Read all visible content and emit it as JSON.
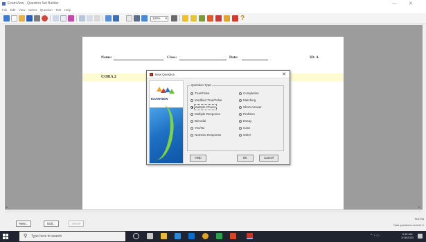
{
  "window": {
    "title": "ExamView - Question Set Builder",
    "minimize": "—",
    "close": "✕"
  },
  "menu": [
    "File",
    "Edit",
    "View",
    "Select",
    "Question",
    "Test",
    "Help"
  ],
  "toolbar": {
    "zoom_value": "100%"
  },
  "document": {
    "name_label": "Name:",
    "class_label": "Class:",
    "date_label": "Date:",
    "id_label": "ID: A",
    "section_title": "CORA 2"
  },
  "dialog": {
    "title": "New Question",
    "close": "✕",
    "logo_text": "EXAMVIEW",
    "group_label": "Question Type",
    "left_types": [
      {
        "label": "True/False",
        "selected": false
      },
      {
        "label": "Modified True/False",
        "selected": false
      },
      {
        "label": "Multiple Choice",
        "selected": true
      },
      {
        "label": "Multiple Response",
        "selected": false
      },
      {
        "label": "Bimodal",
        "selected": false
      },
      {
        "label": "Yes/No",
        "selected": false
      },
      {
        "label": "Numeric Response",
        "selected": false
      }
    ],
    "right_types": [
      {
        "label": "Completion",
        "selected": false
      },
      {
        "label": "Matching",
        "selected": false
      },
      {
        "label": "Short Answer",
        "selected": false
      },
      {
        "label": "Problem",
        "selected": false
      },
      {
        "label": "Essay",
        "selected": false
      },
      {
        "label": "Case",
        "selected": false
      },
      {
        "label": "Other",
        "selected": false
      }
    ],
    "help_button": "Help",
    "ok_button": "OK",
    "cancel_button": "Cancel"
  },
  "bottom": {
    "new_button": "New...",
    "edit_button": "Edit...",
    "delete_button": "Delete",
    "status_top": "Test Ma",
    "status_bottom": "Total questions on test: 0"
  },
  "taskbar": {
    "search_placeholder": "Type here to search",
    "time": "5:45 AM",
    "date": "2/16/2020"
  },
  "colors": {
    "doc_background": "#9c9c9c",
    "section_band": "#fdfbd2",
    "taskbar": "#1f2430",
    "accent_blue": "#1e6fc2"
  }
}
